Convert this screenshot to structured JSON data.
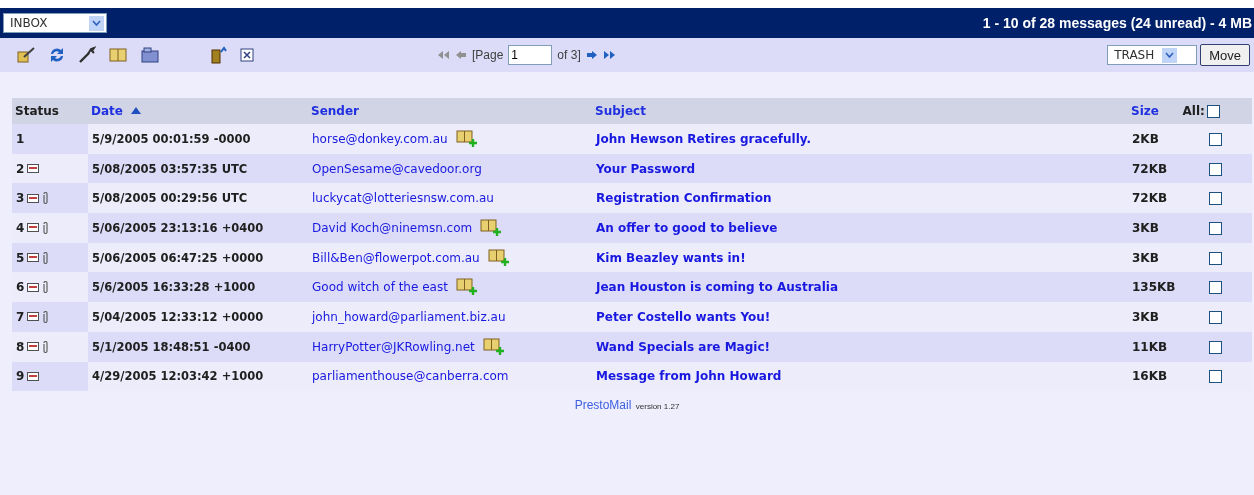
{
  "folder_select": {
    "value": "INBOX"
  },
  "summary": "1 - 10 of 28 messages (24 unread) - 4 MB",
  "pager": {
    "label_before": "[Page",
    "page": "1",
    "label_after": "of 3]"
  },
  "move": {
    "folder": "TRASH",
    "button": "Move"
  },
  "table": {
    "columns": [
      {
        "label": "Status",
        "sortable": false,
        "sorted": false
      },
      {
        "label": "Date",
        "sortable": true,
        "sorted": true
      },
      {
        "label": "Sender",
        "sortable": true,
        "sorted": false
      },
      {
        "label": "Subject",
        "sortable": true,
        "sorted": false
      },
      {
        "label": "Size",
        "sortable": true,
        "sorted": false
      }
    ],
    "select_all": {
      "label": "All:",
      "checked": false
    },
    "rows": [
      {
        "number": "1",
        "envelope": false,
        "attachment": false,
        "date": "5/9/2005 00:01:59 -0000",
        "sender": "horse@donkey.com.au",
        "add_contact": true,
        "subject": "John Hewson Retires gracefully.",
        "size": "2KB",
        "checked": false
      },
      {
        "number": "2",
        "envelope": true,
        "attachment": false,
        "date": "5/08/2005 03:57:35 UTC",
        "sender": "OpenSesame@cavedoor.org",
        "add_contact": false,
        "subject": "Your Password",
        "size": "72KB",
        "checked": false
      },
      {
        "number": "3",
        "envelope": true,
        "attachment": true,
        "date": "5/08/2005 00:29:56 UTC",
        "sender": "luckycat@lotteriesnsw.com.au",
        "add_contact": false,
        "subject": "Registration Confirmation",
        "size": "72KB",
        "checked": false
      },
      {
        "number": "4",
        "envelope": true,
        "attachment": true,
        "date": "5/06/2005 23:13:16 +0400",
        "sender": "David Koch@ninemsn.com",
        "add_contact": true,
        "subject": "An offer to good to believe",
        "size": "3KB",
        "checked": false
      },
      {
        "number": "5",
        "envelope": true,
        "attachment": true,
        "date": "5/06/2005 06:47:25 +0000",
        "sender": "Bill&Ben@flowerpot.com.au",
        "add_contact": true,
        "subject": "Kim Beazley wants in!",
        "size": "3KB",
        "checked": false
      },
      {
        "number": "6",
        "envelope": true,
        "attachment": true,
        "date": "5/6/2005 16:33:28 +1000",
        "sender": "Good witch of the east",
        "add_contact": true,
        "subject": "Jean Houston is coming to Australia",
        "size": "135KB",
        "checked": false
      },
      {
        "number": "7",
        "envelope": true,
        "attachment": true,
        "date": "5/04/2005 12:33:12 +0000",
        "sender": "john_howard@parliament.biz.au",
        "add_contact": false,
        "subject": "Peter Costello wants You!",
        "size": "3KB",
        "checked": false
      },
      {
        "number": "8",
        "envelope": true,
        "attachment": true,
        "date": "5/1/2005 18:48:51 -0400",
        "sender": "HarryPotter@JKRowling.net",
        "add_contact": true,
        "subject": "Wand Specials are Magic!",
        "size": "11KB",
        "checked": false
      },
      {
        "number": "9",
        "envelope": true,
        "attachment": false,
        "date": "4/29/2005 12:03:42 +1000",
        "sender": "parliamenthouse@canberra.com",
        "add_contact": false,
        "subject": "Message from John Howard",
        "size": "16KB",
        "checked": false
      }
    ]
  },
  "footer": {
    "product": "PrestoMail",
    "version": "version 1.27"
  }
}
